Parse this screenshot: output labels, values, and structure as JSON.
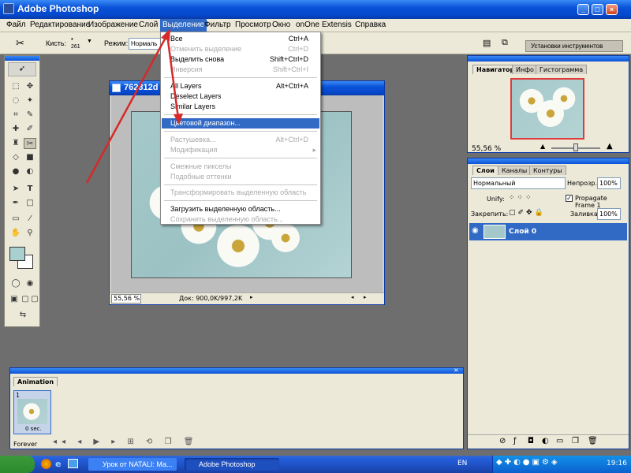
{
  "app": {
    "title": "Adobe Photoshop"
  },
  "menubar": [
    "Файл",
    "Редактирование",
    "Изображение",
    "Слой",
    "Выделение",
    "Фильтр",
    "Просмотр",
    "Окно",
    "onOne",
    "Extensis",
    "Справка"
  ],
  "optionsbar": {
    "brush_label": "Кисть:",
    "brush_size": "261",
    "mode_label": "Режим:",
    "mode_value": "Нормаль",
    "workspace_button": "Установки инструментов"
  },
  "document": {
    "title": "762812d",
    "zoom": "55,56 %",
    "doc_info": "Док: 900,0K/997,2K"
  },
  "select_menu": {
    "items": [
      {
        "label": "Все",
        "shortcut": "Ctrl+A",
        "enabled": true
      },
      {
        "label": "Отменить выделение",
        "shortcut": "Ctrl+D",
        "enabled": false
      },
      {
        "label": "Выделить снова",
        "shortcut": "Shift+Ctrl+D",
        "enabled": true
      },
      {
        "label": "Инверсия",
        "shortcut": "Shift+Ctrl+I",
        "enabled": false
      },
      {
        "label": "All Layers",
        "shortcut": "Alt+Ctrl+A",
        "enabled": true
      },
      {
        "label": "Deselect Layers",
        "shortcut": "",
        "enabled": true
      },
      {
        "label": "Similar Layers",
        "shortcut": "",
        "enabled": true
      },
      {
        "label": "Цветовой диапазон...",
        "shortcut": "",
        "enabled": true,
        "highlighted": true
      },
      {
        "label": "Растушевка...",
        "shortcut": "Alt+Ctrl+D",
        "enabled": false
      },
      {
        "label": "Модификация",
        "shortcut": "▸",
        "enabled": false
      },
      {
        "label": "Смежные пикселы",
        "shortcut": "",
        "enabled": false
      },
      {
        "label": "Подобные оттенки",
        "shortcut": "",
        "enabled": false
      },
      {
        "label": "Трансформировать выделенную область",
        "shortcut": "",
        "enabled": false
      },
      {
        "label": "Загрузить выделенную область...",
        "shortcut": "",
        "enabled": true
      },
      {
        "label": "Сохранить выделенную область...",
        "shortcut": "",
        "enabled": false
      }
    ]
  },
  "navigator": {
    "tabs": [
      "Навигатор",
      "Инфо",
      "Гистограмма"
    ],
    "zoom": "55,56 %"
  },
  "layers": {
    "tabs": [
      "Слои",
      "Каналы",
      "Контуры"
    ],
    "blend_mode": "Нормальный",
    "opacity_label": "Непрозр.:",
    "opacity_value": "100%",
    "unify_label": "Unify:",
    "propagate_label": "Propagate Frame 1",
    "lock_label": "Закрепить:",
    "fill_label": "Заливка:",
    "fill_value": "100%",
    "layer_name": "Слой 0"
  },
  "animation": {
    "tab": "Animation",
    "frame_number": "1",
    "frame_delay": "0 sec.",
    "loop": "Forever"
  },
  "taskbar": {
    "tasks": [
      "Урок от NATALI: Ма...",
      "Adobe Photoshop"
    ],
    "language": "EN",
    "clock": "19:16"
  },
  "colors": {
    "xp_blue": "#0a52d8",
    "menu_highlight": "#316ac5",
    "annotation_arrow": "#d42a2a"
  }
}
